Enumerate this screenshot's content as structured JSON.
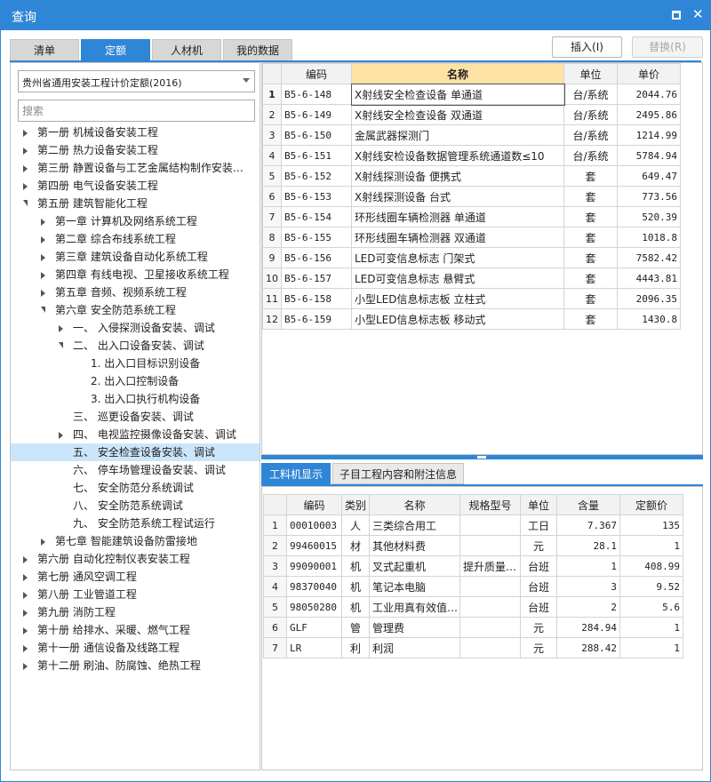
{
  "window": {
    "title": "查询"
  },
  "tabs": [
    "清单",
    "定额",
    "人材机",
    "我的数据"
  ],
  "active_tab": 1,
  "toolbar": {
    "insert_label": "插入(I)",
    "replace_label": "替换(R)"
  },
  "rate_select": "贵州省通用安装工程计价定额(2016)",
  "search_placeholder": "搜索",
  "tree": [
    {
      "label": "第一册 机械设备安装工程",
      "level": 0,
      "state": "collapsed"
    },
    {
      "label": "第二册 热力设备安装工程",
      "level": 0,
      "state": "collapsed"
    },
    {
      "label": "第三册 静置设备与工艺金属结构制作安装…",
      "level": 0,
      "state": "collapsed"
    },
    {
      "label": "第四册 电气设备安装工程",
      "level": 0,
      "state": "collapsed"
    },
    {
      "label": "第五册 建筑智能化工程",
      "level": 0,
      "state": "expanded"
    },
    {
      "label": "第一章 计算机及网络系统工程",
      "level": 1,
      "state": "collapsed"
    },
    {
      "label": "第二章 综合布线系统工程",
      "level": 1,
      "state": "collapsed"
    },
    {
      "label": "第三章 建筑设备自动化系统工程",
      "level": 1,
      "state": "collapsed"
    },
    {
      "label": "第四章 有线电视、卫星接收系统工程",
      "level": 1,
      "state": "collapsed"
    },
    {
      "label": "第五章 音频、视频系统工程",
      "level": 1,
      "state": "collapsed"
    },
    {
      "label": "第六章 安全防范系统工程",
      "level": 1,
      "state": "expanded"
    },
    {
      "label": "一、 入侵探测设备安装、调试",
      "level": 2,
      "state": "collapsed"
    },
    {
      "label": "二、 出入口设备安装、调试",
      "level": 2,
      "state": "expanded"
    },
    {
      "label": "1. 出入口目标识别设备",
      "level": 3,
      "state": "leaf"
    },
    {
      "label": "2. 出入口控制设备",
      "level": 3,
      "state": "leaf"
    },
    {
      "label": "3. 出入口执行机构设备",
      "level": 3,
      "state": "leaf"
    },
    {
      "label": "三、 巡更设备安装、调试",
      "level": 2,
      "state": "leaf"
    },
    {
      "label": "四、 电视监控摄像设备安装、调试",
      "level": 2,
      "state": "collapsed"
    },
    {
      "label": "五、 安全检查设备安装、调试",
      "level": 2,
      "state": "leaf",
      "selected": true
    },
    {
      "label": "六、 停车场管理设备安装、调试",
      "level": 2,
      "state": "leaf"
    },
    {
      "label": "七、 安全防范分系统调试",
      "level": 2,
      "state": "leaf"
    },
    {
      "label": "八、 安全防范系统调试",
      "level": 2,
      "state": "leaf"
    },
    {
      "label": "九、 安全防范系统工程试运行",
      "level": 2,
      "state": "leaf"
    },
    {
      "label": "第七章 智能建筑设备防雷接地",
      "level": 1,
      "state": "collapsed"
    },
    {
      "label": "第六册 自动化控制仪表安装工程",
      "level": 0,
      "state": "collapsed"
    },
    {
      "label": "第七册 通风空调工程",
      "level": 0,
      "state": "collapsed"
    },
    {
      "label": "第八册 工业管道工程",
      "level": 0,
      "state": "collapsed"
    },
    {
      "label": "第九册 消防工程",
      "level": 0,
      "state": "collapsed"
    },
    {
      "label": "第十册 给排水、采暖、燃气工程",
      "level": 0,
      "state": "collapsed"
    },
    {
      "label": "第十一册 通信设备及线路工程",
      "level": 0,
      "state": "collapsed"
    },
    {
      "label": "第十二册 刷油、防腐蚀、绝热工程",
      "level": 0,
      "state": "collapsed"
    }
  ],
  "item_table": {
    "headers": [
      "编码",
      "名称",
      "单位",
      "单价"
    ],
    "rows": [
      {
        "no": "1",
        "code": "B5-6-148",
        "name": "X射线安全检查设备 单通道",
        "unit": "台/系统",
        "price": "2044.76"
      },
      {
        "no": "2",
        "code": "B5-6-149",
        "name": "X射线安全检查设备 双通道",
        "unit": "台/系统",
        "price": "2495.86"
      },
      {
        "no": "3",
        "code": "B5-6-150",
        "name": "金属武器探测门",
        "unit": "台/系统",
        "price": "1214.99"
      },
      {
        "no": "4",
        "code": "B5-6-151",
        "name": "X射线安检设备数据管理系统通道数≤10",
        "unit": "台/系统",
        "price": "5784.94"
      },
      {
        "no": "5",
        "code": "B5-6-152",
        "name": "X射线探测设备 便携式",
        "unit": "套",
        "price": "649.47"
      },
      {
        "no": "6",
        "code": "B5-6-153",
        "name": "X射线探测设备 台式",
        "unit": "套",
        "price": "773.56"
      },
      {
        "no": "7",
        "code": "B5-6-154",
        "name": "环形线圈车辆检测器 单通道",
        "unit": "套",
        "price": "520.39"
      },
      {
        "no": "8",
        "code": "B5-6-155",
        "name": "环形线圈车辆检测器 双通道",
        "unit": "套",
        "price": "1018.8"
      },
      {
        "no": "9",
        "code": "B5-6-156",
        "name": "LED可变信息标志 门架式",
        "unit": "套",
        "price": "7582.42"
      },
      {
        "no": "10",
        "code": "B5-6-157",
        "name": "LED可变信息标志 悬臂式",
        "unit": "套",
        "price": "4443.81"
      },
      {
        "no": "11",
        "code": "B5-6-158",
        "name": "小型LED信息标志板 立柱式",
        "unit": "套",
        "price": "2096.35"
      },
      {
        "no": "12",
        "code": "B5-6-159",
        "name": "小型LED信息标志板 移动式",
        "unit": "套",
        "price": "1430.8"
      }
    ]
  },
  "bottom_tabs": [
    "工料机显示",
    "子目工程内容和附注信息"
  ],
  "resource_table": {
    "headers": [
      "编码",
      "类别",
      "名称",
      "规格型号",
      "单位",
      "含量",
      "定额价"
    ],
    "rows": [
      {
        "no": "1",
        "code": "00010003",
        "type": "人",
        "name": "三类综合用工",
        "spec": "",
        "unit": "工日",
        "qty": "7.367",
        "price": "135"
      },
      {
        "no": "2",
        "code": "99460015",
        "type": "材",
        "name": "其他材料费",
        "spec": "",
        "unit": "元",
        "qty": "28.1",
        "price": "1"
      },
      {
        "no": "3",
        "code": "99090001",
        "type": "机",
        "name": "叉式起重机",
        "spec": "提升质量…",
        "unit": "台班",
        "qty": "1",
        "price": "408.99"
      },
      {
        "no": "4",
        "code": "98370040",
        "type": "机",
        "name": "笔记本电脑",
        "spec": "",
        "unit": "台班",
        "qty": "3",
        "price": "9.52"
      },
      {
        "no": "5",
        "code": "98050280",
        "type": "机",
        "name": "工业用真有效值…",
        "spec": "",
        "unit": "台班",
        "qty": "2",
        "price": "5.6"
      },
      {
        "no": "6",
        "code": "GLF",
        "type": "管",
        "name": "管理费",
        "spec": "",
        "unit": "元",
        "qty": "284.94",
        "price": "1"
      },
      {
        "no": "7",
        "code": "LR",
        "type": "利",
        "name": "利润",
        "spec": "",
        "unit": "元",
        "qty": "288.42",
        "price": "1"
      }
    ]
  }
}
